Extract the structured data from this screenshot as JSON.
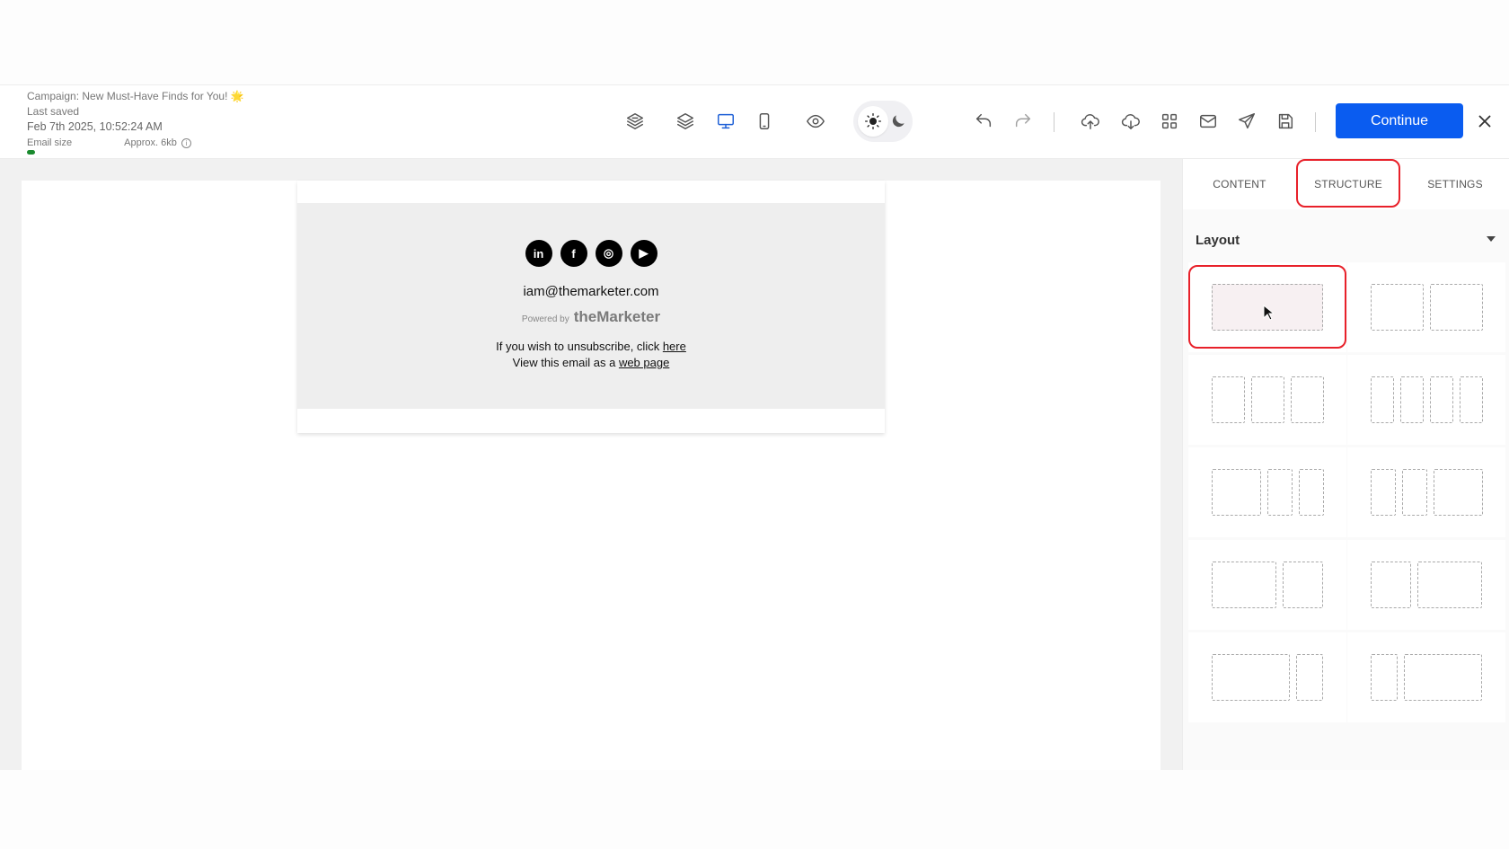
{
  "header": {
    "campaign": "Campaign: New Must-Have Finds for You! 🌟",
    "last_saved_label": "Last saved",
    "last_saved_date": "Feb 7th 2025, 10:52:24 AM",
    "email_size_label": "Email size",
    "email_size_value": "Approx. 6kb",
    "email_size_fill": 0.05,
    "continue_label": "Continue"
  },
  "toolbar_icons": [
    "layers-stack-icon",
    "layers-icon",
    "desktop-icon",
    "mobile-icon",
    "preview-eye-icon",
    "sun-icon",
    "moon-icon",
    "undo-icon",
    "redo-icon",
    "upload-icon",
    "download-icon",
    "grid-icon",
    "mail-icon",
    "send-icon",
    "save-icon",
    "close-icon"
  ],
  "colors": {
    "accent": "#0a5cf0",
    "highlight": "#e8212a",
    "size_bar": "#1a8a2e"
  },
  "email": {
    "socials": [
      "in",
      "f",
      "◎",
      "▶"
    ],
    "address": "iam@themarketer.com",
    "powered_by": "Powered by",
    "brand": "theMarketer",
    "unsub_text": "If you wish to unsubscribe, click",
    "unsub_link": "here",
    "webpage_text": "View this email as a",
    "webpage_link": "web page"
  },
  "panel": {
    "tabs": [
      "CONTENT",
      "STRUCTURE",
      "SETTINGS"
    ],
    "active_tab": "STRUCTURE",
    "section_title": "Layout",
    "layouts": [
      {
        "name": "1 column",
        "cols": [
          1
        ]
      },
      {
        "name": "2 columns",
        "cols": [
          1,
          1
        ]
      },
      {
        "name": "3 columns",
        "cols": [
          1,
          1,
          1
        ]
      },
      {
        "name": "4 columns",
        "cols": [
          1,
          1,
          1,
          1
        ]
      },
      {
        "name": "2-1-1",
        "cols": [
          2,
          1,
          1
        ]
      },
      {
        "name": "1-1-2",
        "cols": [
          1,
          1,
          2
        ]
      },
      {
        "name": "3-2",
        "cols": [
          1.6,
          1
        ]
      },
      {
        "name": "2-3",
        "cols": [
          1,
          1.6
        ]
      },
      {
        "name": "3-1",
        "cols": [
          2.9,
          1
        ]
      },
      {
        "name": "1-3",
        "cols": [
          1,
          2.9
        ]
      }
    ],
    "selected_layout": 0
  }
}
